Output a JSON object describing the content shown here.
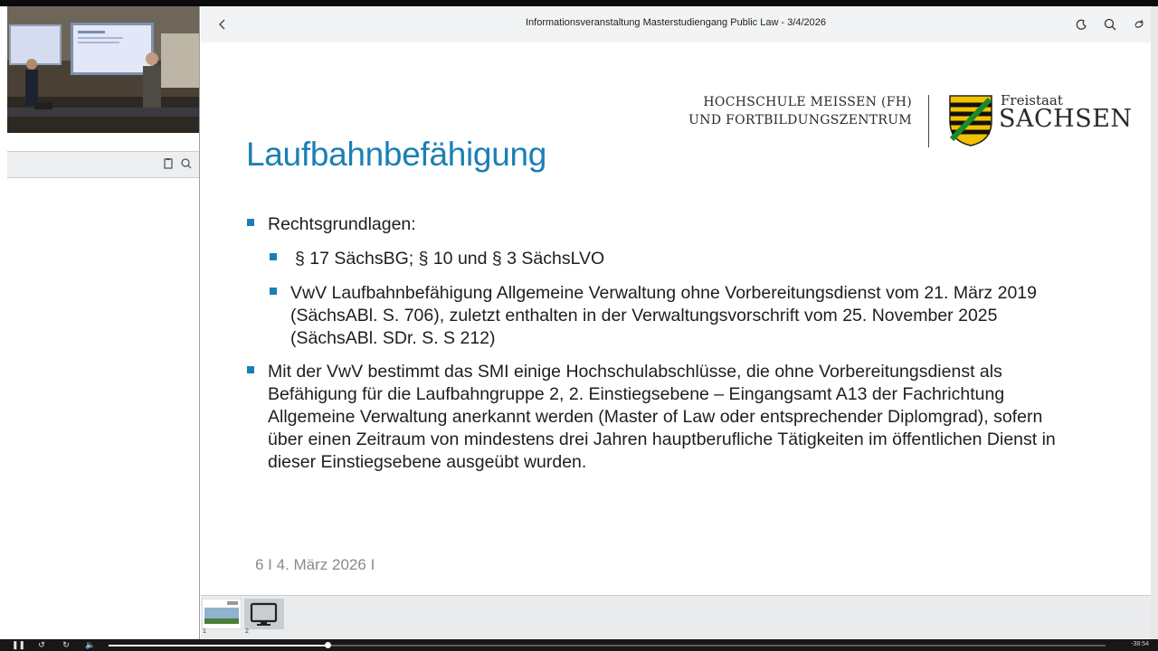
{
  "header": {
    "title": "Informationsveranstaltung Masterstudiengang Public Law - 3/4/2026"
  },
  "icons": {
    "back": "chevron-left-icon",
    "theme": "moon-icon",
    "search": "search-icon",
    "refresh": "refresh-icon",
    "notes": "notes-icon",
    "chat": "chat-icon"
  },
  "slide": {
    "title": "Laufbahnbefähigung",
    "logo": {
      "line1": "HOCHSCHULE MEISSEN (FH)",
      "line2": "UND FORTBILDUNGSZENTRUM",
      "freistaat": "Freistaat",
      "sachsen": "SACHSEN"
    },
    "bullets": [
      "Rechtsgrundlagen:",
      "§ 17 SächsBG;  § 10 und § 3 SächsLVO",
      [
        "VwV Laufbahnbefähigung Allgemeine Verwaltung ohne Vorbereitungsdienst vom 21. März 2019",
        "(SächsABl. S. 706), zuletzt enthalten in der Verwaltungsvorschrift vom 25. November 2025",
        "(SächsABl. SDr. S. S 212)"
      ],
      [
        "Mit der VwV bestimmt das SMI einige Hochschulabschlüsse, die ohne Vorbereitungsdienst als",
        "Befähigung für die Laufbahngruppe 2, 2. Einstiegsebene – Eingangsamt A13 der Fachrichtung",
        "Allgemeine Verwaltung anerkannt werden (Master of Law oder entsprechender Diplomgrad), sofern",
        "über einen Zeitraum von mindestens drei Jahren hauptberufliche Tätigkeiten im öffentlichen Dienst in",
        "dieser Einstiegsebene ausgeübt wurden."
      ]
    ],
    "footer": "6   I 4. März 2026 I"
  },
  "thumbnails": [
    {
      "number": "1"
    },
    {
      "number": "2"
    }
  ],
  "player": {
    "time": "-38:54",
    "progress": 0.22
  },
  "colors": {
    "accent": "#1a7fb6",
    "header_bg": "#f1f3f4"
  }
}
